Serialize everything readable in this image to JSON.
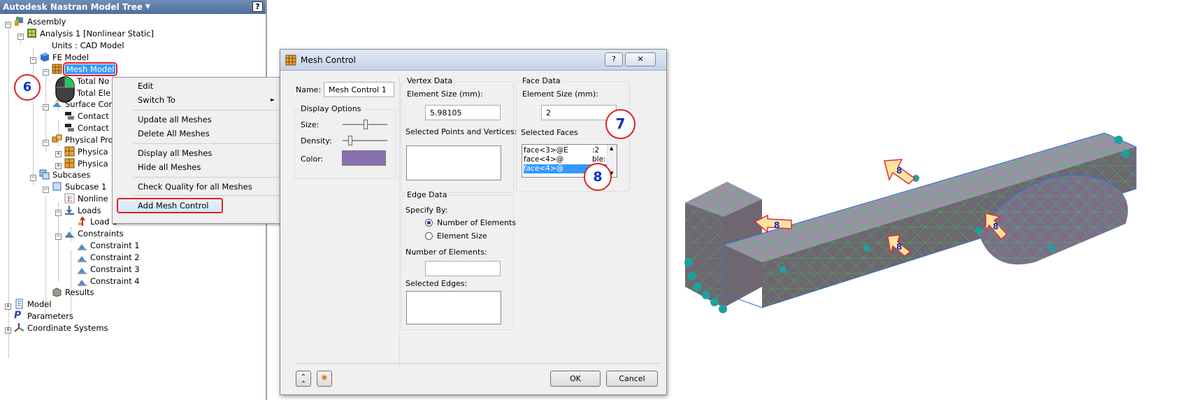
{
  "tree": {
    "title": "Autodesk Nastran Model Tree",
    "help": "?",
    "nodes": [
      {
        "label": "Assembly"
      },
      {
        "label": "Analysis 1 [Nonlinear Static]"
      },
      {
        "label": "Units : CAD Model"
      },
      {
        "label": "FE Model"
      },
      {
        "label": "Mesh Model"
      },
      {
        "label": "Total No"
      },
      {
        "label": "Total Ele"
      },
      {
        "label": "Surface Cor"
      },
      {
        "label": "Contact"
      },
      {
        "label": "Contact"
      },
      {
        "label": "Physical Pro"
      },
      {
        "label": "Physica"
      },
      {
        "label": "Physica"
      },
      {
        "label": "Subcases"
      },
      {
        "label": "Subcase 1"
      },
      {
        "label": "Nonline"
      },
      {
        "label": "Loads"
      },
      {
        "label": "Load 1"
      },
      {
        "label": "Constraints"
      },
      {
        "label": "Constraint 1"
      },
      {
        "label": "Constraint 2"
      },
      {
        "label": "Constraint 3"
      },
      {
        "label": "Constraint 4"
      },
      {
        "label": "Results"
      },
      {
        "label": "Model"
      },
      {
        "label": "Parameters"
      },
      {
        "label": "Coordinate Systems"
      }
    ]
  },
  "context_menu": {
    "items": [
      {
        "label": "Edit"
      },
      {
        "label": "Switch To"
      },
      {
        "label": "Update all Meshes"
      },
      {
        "label": "Delete All Meshes"
      },
      {
        "label": "Display all Meshes"
      },
      {
        "label": "Hide all Meshes"
      },
      {
        "label": "Check Quality for all Meshes"
      },
      {
        "label": "Add Mesh Control"
      }
    ],
    "submenu_arrow": "►"
  },
  "callouts": {
    "step6": "6",
    "step7": "7",
    "step8": "8"
  },
  "dialog": {
    "title": "Mesh Control",
    "help_btn": "?",
    "close_btn": "✕",
    "name_label": "Name:",
    "name_value": "Mesh Control 1",
    "display_options": {
      "title": "Display Options",
      "size": "Size:",
      "density": "Density:",
      "color": "Color:",
      "color_value": "#8870b0"
    },
    "vertex": {
      "title": "Vertex Data",
      "size_label": "Element Size (mm):",
      "size_value": "5.98105",
      "points_label": "Selected Points and Vertices:"
    },
    "face": {
      "title": "Face Data",
      "size_label": "Element Size (mm):",
      "size_value": "2",
      "faces_label": "Selected Faces",
      "faces": [
        "face<3>@E",
        "face<4>@",
        "face<4>@"
      ],
      "faces_tail": [
        ":2",
        "ble:",
        ":1"
      ]
    },
    "edge": {
      "title": "Edge Data",
      "specify_label": "Specify By:",
      "opt_num": "Number of Elements",
      "opt_size": "Element Size",
      "num_label": "Number of Elements:",
      "edges_label": "Selected Edges:"
    },
    "ok": "OK",
    "cancel": "Cancel"
  },
  "colors": {
    "accent": "#3399ff",
    "callout_ring": "#e02020",
    "callout_text": "#1030c0",
    "mesh_fill": "#8a8097",
    "mesh_line": "#29e04a",
    "constraint": "#1fa0a0"
  }
}
